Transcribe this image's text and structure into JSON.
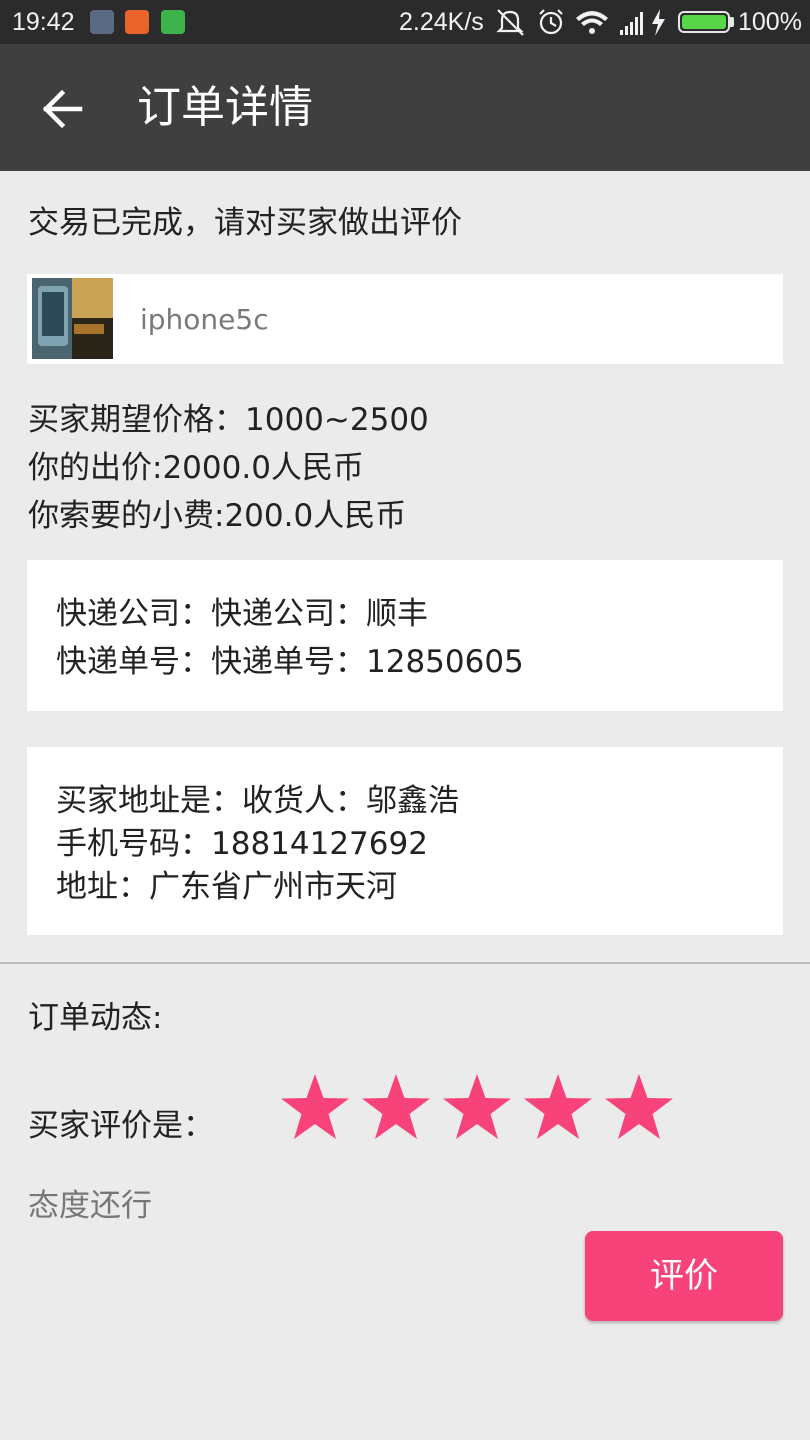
{
  "status_bar": {
    "time": "19:42",
    "network_speed": "2.24K/s",
    "battery_percent": "100%",
    "battery_level": 1.0,
    "icons": [
      "app-icon",
      "app-icon",
      "app-icon",
      "mute-icon",
      "alarm-icon",
      "wifi-icon",
      "signal-icon",
      "charging-icon",
      "battery-icon"
    ]
  },
  "toolbar": {
    "back_icon": "arrow-left-icon",
    "title": "订单详情"
  },
  "order": {
    "status_text": "交易已完成，请对买家做出评价",
    "product": {
      "name": "iphone5c"
    },
    "expected_price": "买家期望价格：1000~2500",
    "your_offer": "你的出价:2000.0人民币",
    "your_tip": "你索要的小费:200.0人民币"
  },
  "express": {
    "company": "快递公司：快递公司：顺丰",
    "tracking": "快递单号：快递单号：12850605"
  },
  "address": {
    "receiver": "买家地址是：收货人：邬鑫浩",
    "phone": "手机号码：18814127692",
    "location": "地址：广东省广州市天河"
  },
  "dynamics": {
    "label": "订单动态:"
  },
  "rating": {
    "label": "买家评价是：",
    "stars": 5,
    "max_stars": 5,
    "star_color": "#f7437a",
    "comment": "态度还行"
  },
  "actions": {
    "rate_button": "评价",
    "rate_button_color": "#f7437a"
  }
}
